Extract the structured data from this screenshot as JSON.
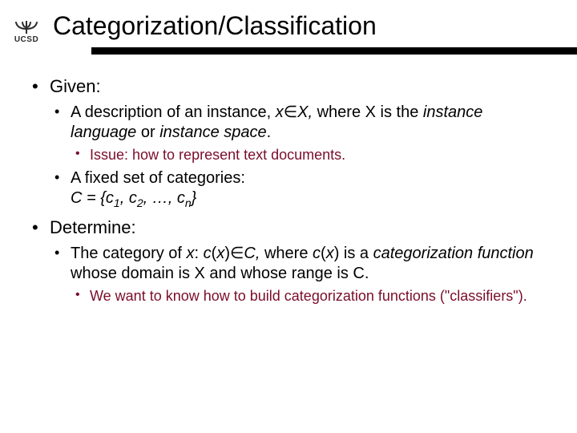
{
  "logo_text": "UCSD",
  "title": "Categorization/Classification",
  "bullets": {
    "given_label": "Given:",
    "given_items": {
      "desc_pre": "A description of an instance, ",
      "desc_mid_x": "x",
      "desc_in": "∈",
      "desc_mid_X": "X,",
      "desc_post1": " where X is the ",
      "desc_em1": "instance language",
      "desc_or": " or ",
      "desc_em2": "instance space",
      "desc_post2": ".",
      "desc_sub": "Issue: how to represent text documents.",
      "cats_line1": "A fixed set of categories:",
      "cats_line2_pre": "C = {c",
      "cats_s1": "1",
      "cats_c2": ", c",
      "cats_s2": "2",
      "cats_dots": ", …, c",
      "cats_sn": "n",
      "cats_end": "}"
    },
    "determine_label": "Determine:",
    "determine_items": {
      "cat_pre": "The category of ",
      "cat_x1": "x",
      "cat_colon": ": ",
      "cat_cx1": "c",
      "cat_paren1": "(",
      "cat_x2": "x",
      "cat_paren2": ")",
      "cat_in": "∈",
      "cat_C": "C,",
      "cat_where": " where ",
      "cat_cx2": "c",
      "cat_paren3": "(",
      "cat_x3": "x",
      "cat_paren4": ")",
      "cat_isa": " is a ",
      "cat_em": "categorization function",
      "cat_rest": " whose domain is X and whose range is C.",
      "cat_sub": "We want to know how to build categorization functions (\"classifiers\")."
    }
  }
}
